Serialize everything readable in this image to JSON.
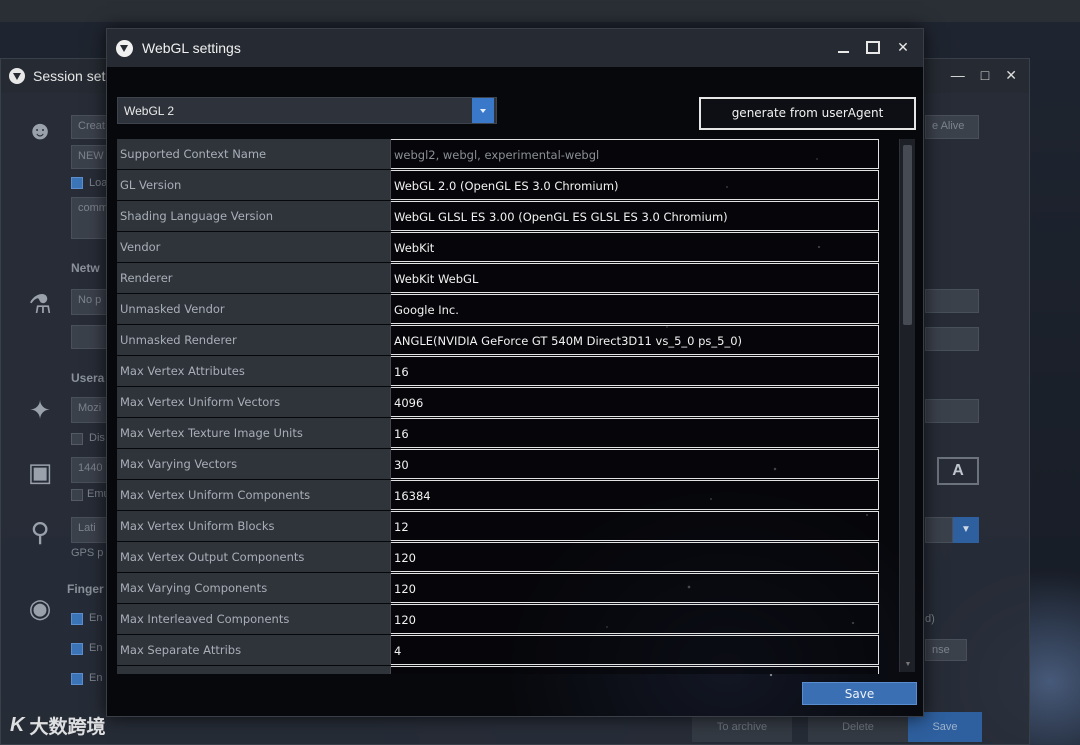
{
  "background_window": {
    "title": "Session set",
    "fields": {
      "create": "Creat",
      "new": "NEW",
      "load": "Loa",
      "comment": "comm",
      "network_label": "Netw",
      "proxy": "No p",
      "useragent_label": "Usera",
      "mozilla": "Mozi",
      "disable": "Dis",
      "resolution": "1440",
      "emulate": "Emu",
      "latitude": "Lati",
      "gps": "GPS p",
      "fingerprint_label": "Finger",
      "enable1": "En",
      "enable2": "En",
      "enable3": "En",
      "right_caption": "e Alive",
      "right_small": "d)",
      "right_small2": "nse",
      "font_icon_label": "A"
    },
    "footer_buttons": [
      "To archive",
      "Delete",
      "Save"
    ]
  },
  "dialog": {
    "title": "WebGL settings",
    "version_select": {
      "value": "WebGL 2"
    },
    "generate_button": "generate from userAgent",
    "save_button": "Save",
    "rows": [
      {
        "name": "Supported Context Name",
        "value": "webgl2, webgl, experimental-webgl",
        "readonly": true
      },
      {
        "name": "GL Version",
        "value": "WebGL 2.0 (OpenGL ES 3.0 Chromium)"
      },
      {
        "name": "Shading Language Version",
        "value": "WebGL GLSL ES 3.00 (OpenGL ES GLSL ES 3.0 Chromium)"
      },
      {
        "name": "Vendor",
        "value": "WebKit"
      },
      {
        "name": "Renderer",
        "value": "WebKit WebGL"
      },
      {
        "name": "Unmasked Vendor",
        "value": "Google Inc."
      },
      {
        "name": "Unmasked Renderer",
        "value": "ANGLE(NVIDIA GeForce GT 540M Direct3D11 vs_5_0 ps_5_0)"
      },
      {
        "name": "Max Vertex Attributes",
        "value": "16"
      },
      {
        "name": "Max Vertex Uniform Vectors",
        "value": "4096"
      },
      {
        "name": "Max Vertex Texture Image Units",
        "value": "16"
      },
      {
        "name": "Max Varying Vectors",
        "value": "30"
      },
      {
        "name": "Max Vertex Uniform Components",
        "value": "16384"
      },
      {
        "name": "Max Vertex Uniform Blocks",
        "value": "12"
      },
      {
        "name": "Max Vertex Output Components",
        "value": "120"
      },
      {
        "name": "Max Varying Components",
        "value": "120"
      },
      {
        "name": "Max Interleaved Components",
        "value": "120"
      },
      {
        "name": "Max Separate Attribs",
        "value": "4"
      },
      {
        "name": "",
        "value": ""
      }
    ]
  },
  "watermark": {
    "logo": "K",
    "text": "大数跨境"
  },
  "colors": {
    "accent": "#3a78c9",
    "save": "#3a6fb3"
  }
}
